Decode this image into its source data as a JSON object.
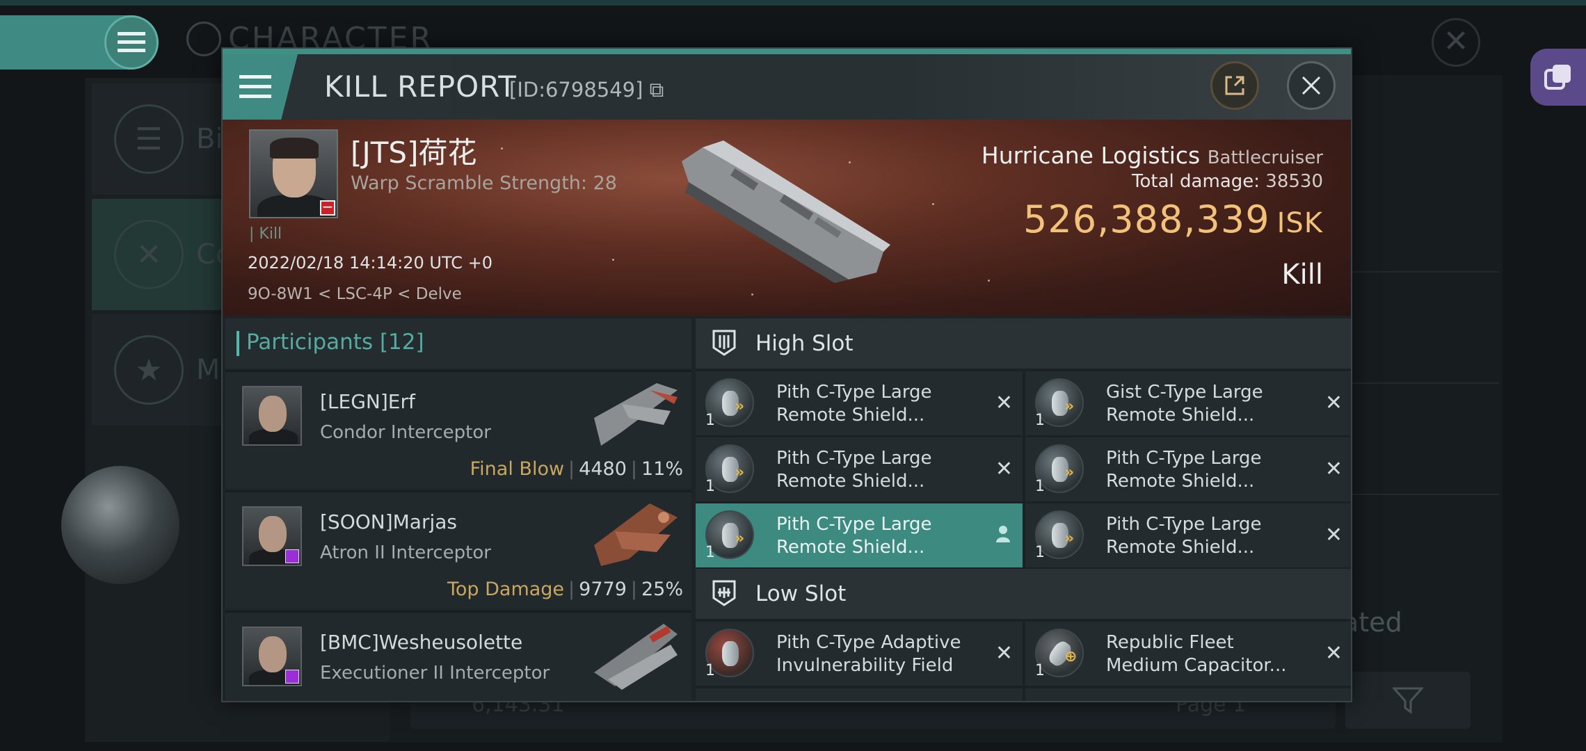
{
  "background": {
    "title": "CHARACTER",
    "nav_labels": [
      "Bi",
      "Co",
      "Mi"
    ],
    "right_text": "ated",
    "bottom_value": "6,143.31",
    "bottom_page": "Page 1"
  },
  "dialog": {
    "title": "KILL REPORT",
    "id": "[ID:6798549]"
  },
  "victim": {
    "name": "[JTS]荷花",
    "subtitle": "Warp Scramble Strength: 28",
    "tag": "Kill",
    "datetime": "2022/02/18 14:14:20 UTC +0",
    "location": "9O-8W1 < LSC-4P < Delve",
    "ship_name": "Hurricane Logistics",
    "ship_class": "Battlecruiser",
    "total_damage_label": "Total damage:",
    "total_damage": "38530",
    "isk_value": "526,388,339",
    "isk_unit": "ISK",
    "result": "Kill"
  },
  "participants": {
    "header": "Participants [12]",
    "rows": [
      {
        "name": "[LEGN]Erf",
        "ship": "Condor Interceptor",
        "label": "Final Blow",
        "damage": "4480",
        "percent": "11%"
      },
      {
        "name": "[SOON]Marjas",
        "ship": "Atron II Interceptor",
        "label": "Top Damage",
        "damage": "9779",
        "percent": "25%"
      },
      {
        "name": "[BMC]Wesheusolette",
        "ship": "Executioner II Interceptor",
        "label": "",
        "damage": "",
        "percent": ""
      }
    ]
  },
  "fitting": {
    "high_slot_label": "High Slot",
    "low_slot_label": "Low Slot",
    "high": [
      {
        "qty": "1",
        "line1": "Pith C-Type Large",
        "line2": "Remote Shield..."
      },
      {
        "qty": "1",
        "line1": "Gist C-Type Large",
        "line2": "Remote Shield..."
      },
      {
        "qty": "1",
        "line1": "Pith C-Type Large",
        "line2": "Remote Shield..."
      },
      {
        "qty": "1",
        "line1": "Pith C-Type Large",
        "line2": "Remote Shield..."
      },
      {
        "qty": "1",
        "line1": "Pith C-Type Large",
        "line2": "Remote Shield..."
      },
      {
        "qty": "1",
        "line1": "Pith C-Type Large",
        "line2": "Remote Shield..."
      }
    ],
    "low": [
      {
        "qty": "1",
        "line1": "Pith C-Type Adaptive",
        "line2": "Invulnerability Field"
      },
      {
        "qty": "1",
        "line1": "Republic Fleet",
        "line2": "Medium Capacitor..."
      }
    ]
  },
  "colors": {
    "accent": "#3f8a82",
    "isk": "#f2c27a",
    "final_blow": "#c9a760"
  }
}
